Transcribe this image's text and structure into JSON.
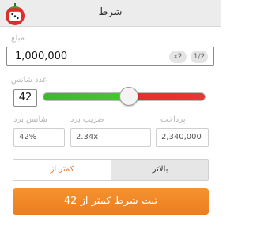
{
  "header": {
    "title": "شرط"
  },
  "amount": {
    "label": "مبلغ",
    "value": "1,000,000",
    "chip_double": "x2",
    "chip_half": "1/2"
  },
  "chance": {
    "label": "عدد شانس",
    "value": "42",
    "slider_fraction": 0.47
  },
  "stats": {
    "win_chance_label": "شانس برد",
    "win_chance_value": "42%",
    "multiplier_label": "ضریب برد",
    "multiplier_value": "2.34x",
    "payout_label": "پرداخت",
    "payout_value": "2,340,000"
  },
  "direction": {
    "under_label": "کمتر از",
    "over_label": "بالاتر"
  },
  "submit": {
    "label": "ثبت شرط کمتر از 42"
  },
  "colors": {
    "accent": "#f0842a",
    "slider_green": "#46c432",
    "slider_red": "#e83535"
  }
}
